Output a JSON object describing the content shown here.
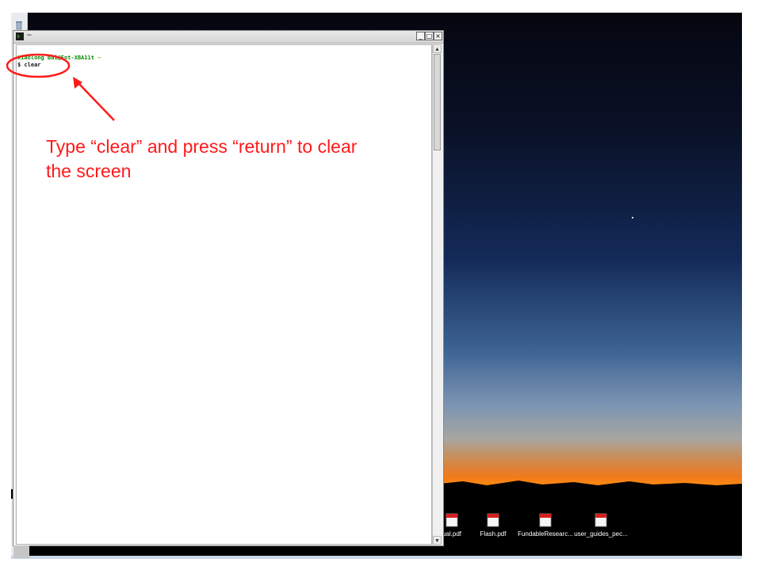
{
  "window": {
    "title": "~",
    "buttons": {
      "minimize": "_",
      "maximize": "□",
      "close": "×"
    }
  },
  "terminal": {
    "prompt_user": "Xiaolong Bai@Ent-XBA11t",
    "prompt_path": "~",
    "prompt_symbol": "$",
    "command": "clear"
  },
  "annotation": {
    "line1": "Type “clear” and press “return” to clear",
    "line2": "the screen",
    "color": "#ff1a1a"
  },
  "desktop_icons": [
    {
      "label": "ual.pdf",
      "icon": "pdf-icon"
    },
    {
      "label": "Flash.pdf",
      "icon": "pdf-icon"
    },
    {
      "label": "FundableResearc...",
      "icon": "pdf-icon"
    },
    {
      "label": "user_guides_pec...",
      "icon": "pdf-icon"
    }
  ],
  "colors": {
    "prompt_user": "#0b8a0b",
    "prompt_path": "#b08a00",
    "annotation_red": "#ff1a1a"
  }
}
